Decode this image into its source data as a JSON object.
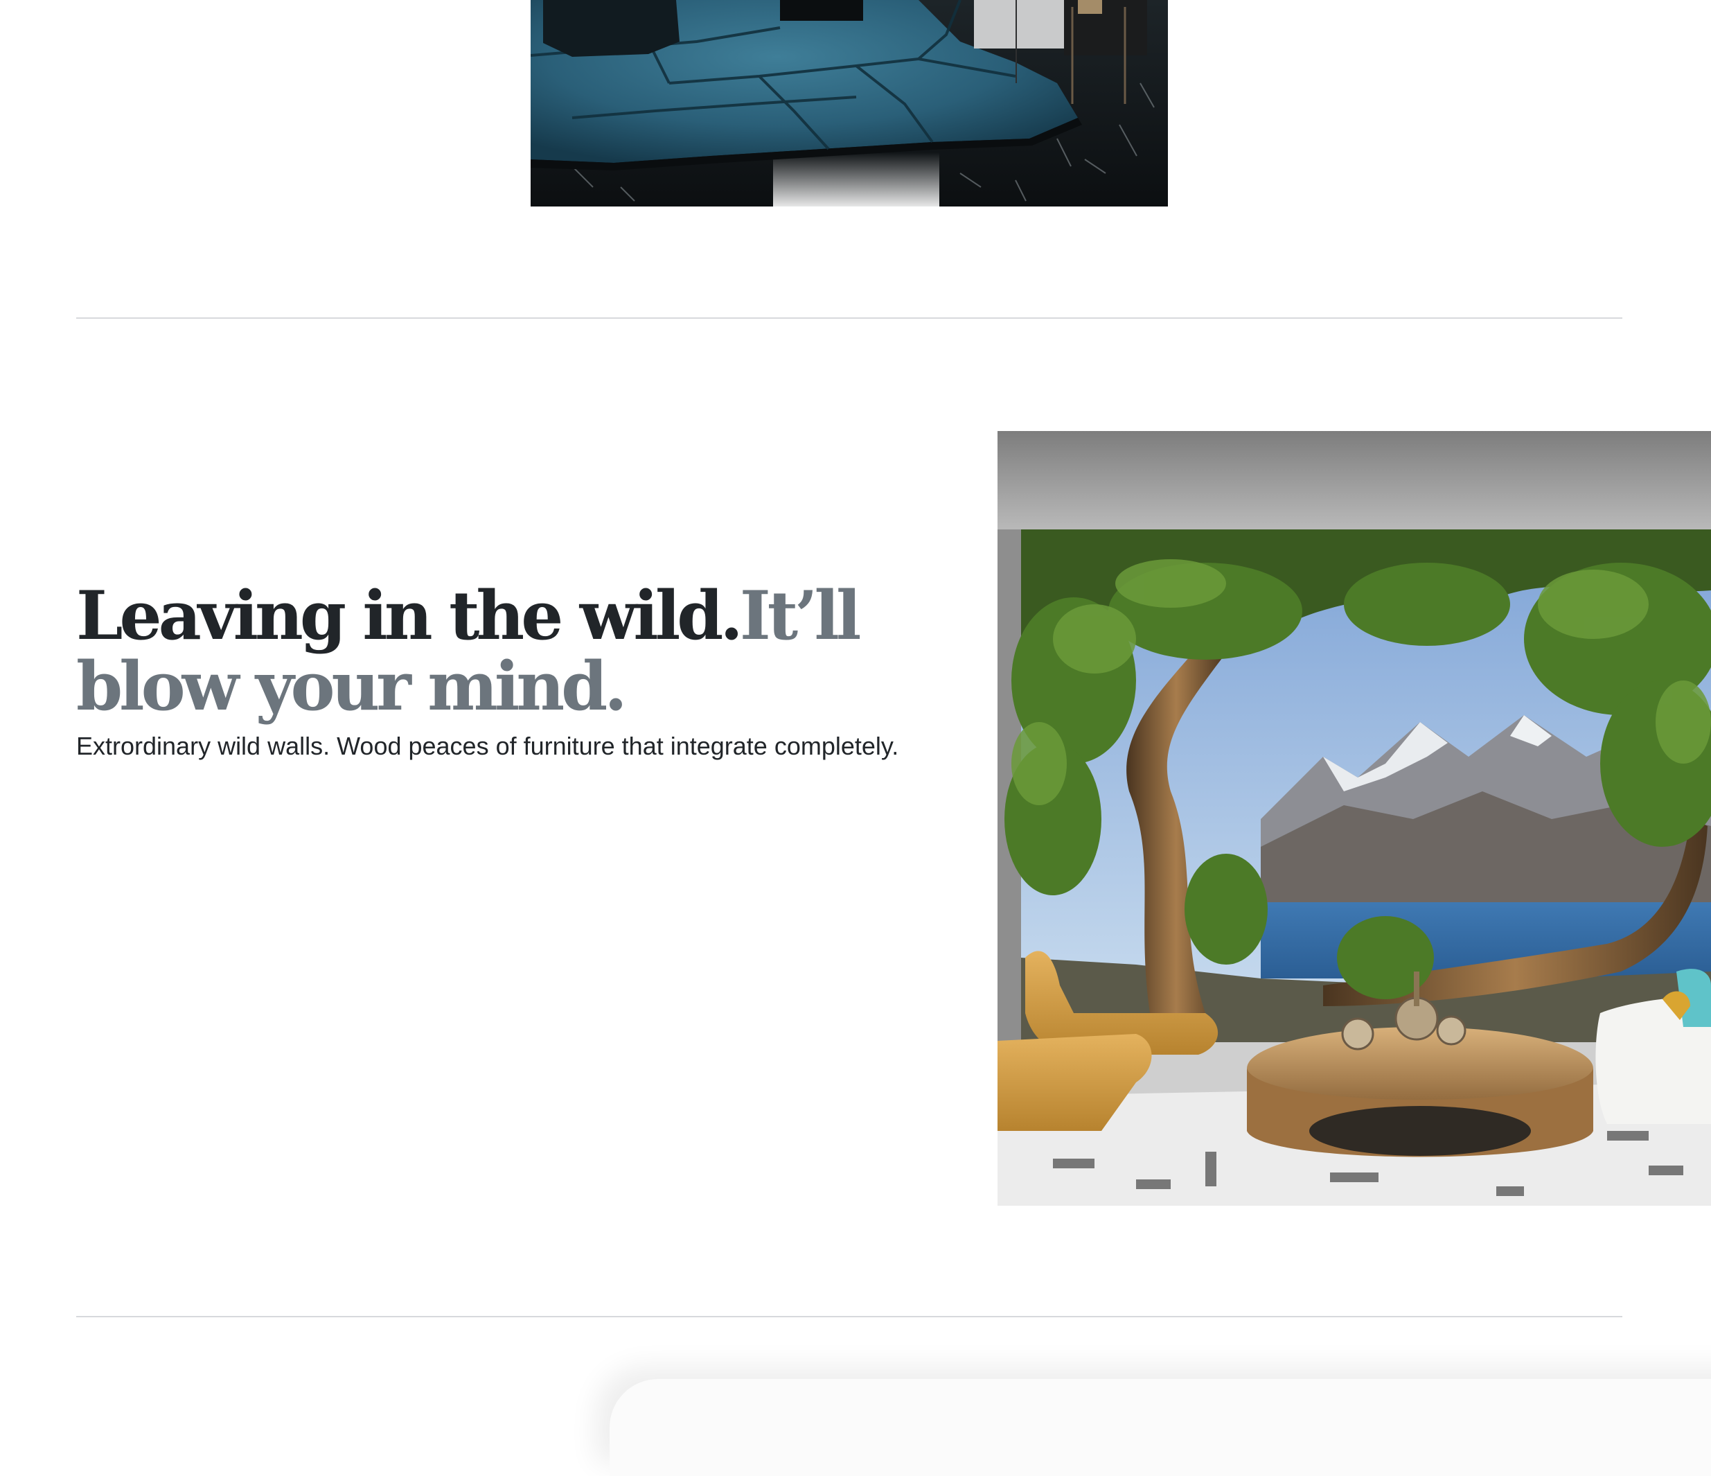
{
  "featurette": {
    "heading_primary": "Leaving in the wild.",
    "heading_muted": "It’ll blow your mind.",
    "lead": "Extrordinary wild walls. Wood peaces of furniture that integrate completely."
  },
  "images": {
    "rug_photo": "interior-blue-rug-photo",
    "wild_wall_photo": "forest-lake-wall-mural-living-room-photo"
  },
  "colors": {
    "heading": "#212529",
    "heading_muted": "#6c757d",
    "divider": "#d7d9dc",
    "background": "#ffffff"
  }
}
